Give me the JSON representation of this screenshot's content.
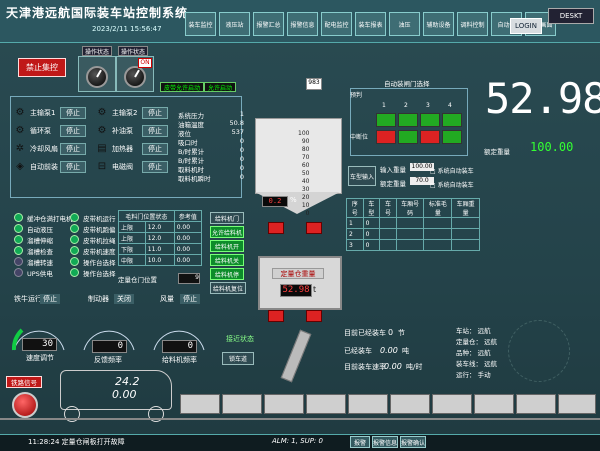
{
  "header": {
    "title": "天津港远航国际装车站控制系统",
    "datetime": "2023/2/11 15:56:47",
    "nav": [
      "装车监控",
      "液压站",
      "报警汇总",
      "报警信息",
      "配电监控",
      "装车报表",
      "油压",
      "辅助设备",
      "调料控制",
      "自动化",
      "收获画面"
    ],
    "login": "LOGIN",
    "desktop": "DESKT"
  },
  "control": {
    "estop_label": "禁止集控",
    "panel1_title": "操作状态",
    "panel2_title": "操作状态",
    "mode_tag": "ON",
    "btn_a": "皮带允许启动",
    "btn_b": "允许启动",
    "counter": "983"
  },
  "equipment": [
    {
      "icon": "pump-icon",
      "label": "主输泵1",
      "state": "停止"
    },
    {
      "icon": "pump-icon",
      "label": "循环泵",
      "state": "停止"
    },
    {
      "icon": "fan-icon",
      "label": "冷却风扇",
      "state": "停止"
    },
    {
      "icon": "valve-icon",
      "label": "自动前装",
      "state": "停止"
    }
  ],
  "equipment2": [
    {
      "label": "主输泵2",
      "state": "停止"
    },
    {
      "label": "补油泵",
      "state": "停止"
    },
    {
      "label": "加热器",
      "state": "停止"
    },
    {
      "label": "电磁阀",
      "state": "停止"
    }
  ],
  "params": [
    {
      "label": "系统压力",
      "value": "1"
    },
    {
      "label": "油箱温度",
      "value": "50.8"
    },
    {
      "label": "液位",
      "value": "537"
    },
    {
      "label": "吸口时",
      "value": "0"
    },
    {
      "label": "B/时累计",
      "value": "0"
    },
    {
      "label": "B/时累计",
      "value": "0"
    },
    {
      "label": "取料机时",
      "value": "0"
    },
    {
      "label": "取料机瞬时",
      "value": "0"
    }
  ],
  "status_left": [
    "缓冲仓满打电机",
    "自动液压",
    "溜槽伸缩",
    "溜槽检查",
    "溜槽转速",
    "UPS供电"
  ],
  "status_right": [
    "皮带机运行",
    "皮带机跑偏",
    "皮带机拉绳",
    "皮带机速度",
    "操作台选择",
    "操作台选择"
  ],
  "mid_table": {
    "headers": [
      "毛料门位置状态",
      "参考值"
    ],
    "rows": [
      [
        "上限",
        "12.0",
        "0.00"
      ],
      [
        "上限",
        "12.0",
        "0.00"
      ],
      [
        "下限",
        "11.0",
        "0.00"
      ],
      [
        "中限",
        "10.0",
        "0.00"
      ]
    ],
    "footer": "定量仓门位置",
    "footer_value": "9"
  },
  "green_buttons": [
    "允许给料机",
    "给料机开",
    "给料机关",
    "给料机停"
  ],
  "side_button": "给料机门",
  "bottom_buttons": [
    "给料机停止",
    "给料机复位"
  ],
  "hopper": {
    "scale": [
      "100",
      "90",
      "80",
      "70",
      "60",
      "50",
      "40",
      "30",
      "20",
      "10",
      "0"
    ],
    "level_value": "0.2",
    "level_unit": "%",
    "weigh_title": "定量仓重量",
    "weigh_value": "52.98",
    "weigh_unit": "t",
    "track_label": "接近状态",
    "gate_button": "锁车道"
  },
  "right": {
    "matrix_title": "自动装闸门选择",
    "matrix_cols": [
      "1",
      "2",
      "3",
      "4"
    ],
    "matrix_rows": [
      "预判",
      "中断位"
    ],
    "big_weight": "52.98",
    "set_label": "额定重量",
    "set_weight": "100.00",
    "input_btn": "车型输入",
    "fields": [
      {
        "label": "输入重量",
        "value": "100.00"
      },
      {
        "label": "额定重量",
        "value": "70.0"
      }
    ],
    "options": [
      "系统自动装车",
      "系统自动装车"
    ],
    "table_headers": [
      "序号",
      "车型",
      "车号",
      "车厢号码",
      "标准毛量",
      "车厢重量"
    ],
    "table_rows": [
      [
        "1",
        "0",
        "",
        "",
        "",
        ""
      ],
      [
        "2",
        "0",
        "",
        "",
        "",
        ""
      ],
      [
        "3",
        "0",
        "",
        "",
        "",
        ""
      ]
    ]
  },
  "counters": {
    "loaded_label": "目前已经装车",
    "loaded_value": "0",
    "loaded_unit": "节",
    "total_label": "已经装车",
    "total_value": "0.00",
    "total_unit": "吨",
    "rate_label": "目前装车速率",
    "rate_value": "0.00",
    "rate_unit": "吨/时"
  },
  "info": [
    {
      "label": "车站",
      "value": "远航"
    },
    {
      "label": "定量仓",
      "value": "远航"
    },
    {
      "label": "品种",
      "value": "远航"
    },
    {
      "label": "装车线",
      "value": "远航"
    },
    {
      "label": "运行",
      "value": "手动"
    }
  ],
  "gauges": [
    {
      "label": "铁牛运行",
      "state": "停止",
      "value": "30",
      "caption": "速度调节"
    },
    {
      "label": "制动器",
      "state": "关闭",
      "value": "0",
      "caption": "反馈频率"
    },
    {
      "label": "风量",
      "state": "停止",
      "value": "0",
      "caption": "给料机频率"
    }
  ],
  "train": {
    "signal_label": "铁路信号",
    "loco_top": "24.2",
    "loco_bottom": "0.00",
    "cars": 11
  },
  "footer": {
    "alarm": "11:28:24 定量仓闸板打开故障",
    "counts": "ALM: 1, SUP: 0",
    "buttons": [
      "报警",
      "报警信息",
      "报警确认"
    ]
  },
  "colors": {
    "background": "#24434a",
    "stop_red": "#c01818",
    "run_green": "#0d8c2a",
    "display_red": "#ff4040"
  }
}
